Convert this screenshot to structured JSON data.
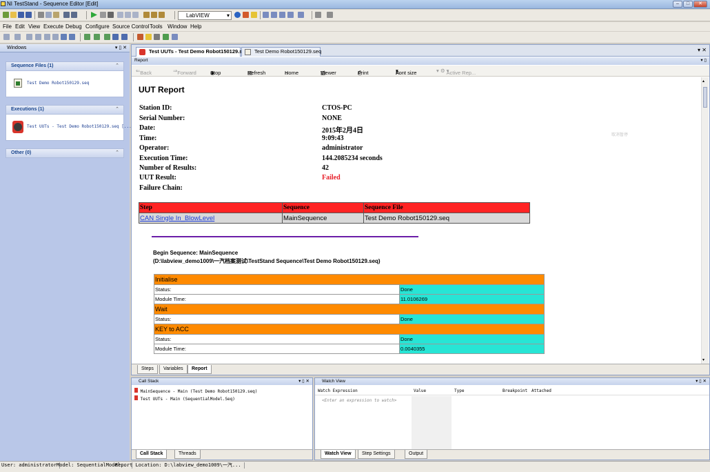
{
  "window": {
    "title": "NI TestStand - Sequence Editor [Edit]"
  },
  "toolbar": {
    "adapter_select": "LabVIEW"
  },
  "menubar": [
    "File",
    "Edit",
    "View",
    "Execute",
    "Debug",
    "Configure",
    "Source Control",
    "Tools",
    "Window",
    "Help"
  ],
  "leftpane": {
    "title": "Windows",
    "groups": [
      {
        "label": "Sequence Files (1)",
        "item": "Test Demo Robot150129.seq"
      },
      {
        "label": "Executions (1)",
        "item": "Test UUTs - Test Demo Robot150129.seq [..."
      },
      {
        "label": "Other (0)"
      }
    ]
  },
  "doc": {
    "tabs": [
      "Test UUTs - Test Demo Robot150129.s...",
      "Test Demo Robot150129.seq"
    ],
    "report_header": "Report",
    "nav": {
      "back": "Back",
      "forward": "Forward",
      "stop": "Stop",
      "refresh": "Refresh",
      "home": "Home",
      "viewer": "Viewer",
      "print": "Print",
      "fontsize": "Font size",
      "activerep": "Active Rep..."
    },
    "report": {
      "title": "UUT Report",
      "fields": [
        {
          "label": "Station ID:",
          "value": "CTOS-PC"
        },
        {
          "label": "Serial Number:",
          "value": "NONE"
        },
        {
          "label": "Date:",
          "value": "2015年2月4日"
        },
        {
          "label": "Time:",
          "value": "9:09:43"
        },
        {
          "label": "Operator:",
          "value": "administrator"
        },
        {
          "label": "Execution Time:",
          "value": "144.2085234 seconds"
        },
        {
          "label": "Number of Results:",
          "value": "42"
        },
        {
          "label": "UUT Result:",
          "value": "Failed"
        },
        {
          "label": "Failure Chain:",
          "value": ""
        }
      ],
      "failure_table": {
        "headers": [
          "Step",
          "Sequence",
          "Sequence File"
        ],
        "row": [
          "CAN Single In_BlowLevel",
          "MainSequence",
          "Test Demo Robot150129.seq"
        ]
      },
      "begin_sequence": "Begin Sequence: MainSequence",
      "seq_path": "(D:\\labview_demo1009\\一汽档案测试\\TestStand Sequence\\Test Demo Robot150129.seq)",
      "steps": [
        {
          "name": "Initialise",
          "rows": [
            [
              "Status:",
              "Done"
            ],
            [
              "Module Time:",
              "11.0106269"
            ]
          ]
        },
        {
          "name": "Wait",
          "rows": [
            [
              "Status:",
              "Done"
            ]
          ]
        },
        {
          "name": "KEY to ACC",
          "rows": [
            [
              "Status:",
              "Done"
            ],
            [
              "Module Time:",
              "0.0040355"
            ]
          ]
        }
      ],
      "watermark": "取消暂停"
    },
    "subtabs": [
      "Steps",
      "Variables",
      "Report"
    ]
  },
  "callstack": {
    "title": "Call Stack",
    "items": [
      "MainSequence - Main (Test Demo Robot150129.seq)",
      "Test UUTs - Main (SequentialModel.Seq)"
    ],
    "tabs": [
      "Call Stack",
      "Threads"
    ]
  },
  "watch": {
    "title": "Watch View",
    "columns": [
      "Watch Expression",
      "Value",
      "Type",
      "Breakpoint",
      "Attached"
    ],
    "placeholder": "<Enter an expression to watch>",
    "tabs": [
      "Watch View",
      "Step Settings",
      "Output"
    ]
  },
  "statusbar": {
    "user": "User: administrator",
    "model": "Model: SequentialModel...",
    "report": "Report Location: D:\\labview_demo1009\\一汽..."
  },
  "colors": {
    "failed": "#e8212b",
    "fail_header": "#ff2323",
    "step_header": "#ff8a00",
    "status_value": "#27e5d5",
    "divider": "#6a1ca8"
  }
}
